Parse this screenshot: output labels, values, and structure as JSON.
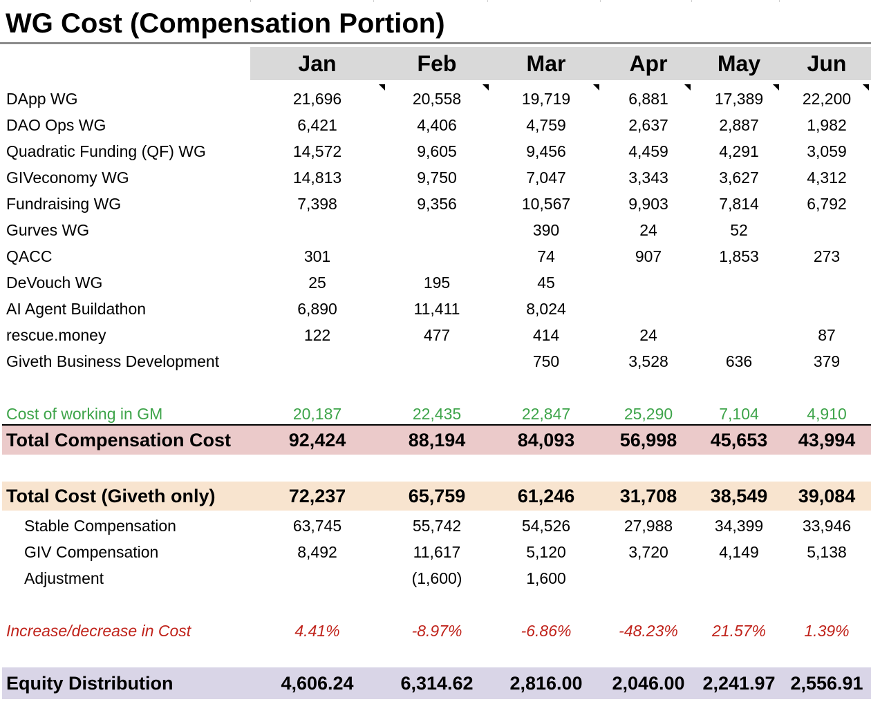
{
  "title": "WG Cost (Compensation Portion)",
  "months": [
    "Jan",
    "Feb",
    "Mar",
    "Apr",
    "May",
    "Jun"
  ],
  "wg_rows": [
    {
      "label": "DApp WG",
      "values": [
        "21,696",
        "20,558",
        "19,719",
        "6,881",
        "17,389",
        "22,200"
      ]
    },
    {
      "label": "DAO Ops WG",
      "values": [
        "6,421",
        "4,406",
        "4,759",
        "2,637",
        "2,887",
        "1,982"
      ]
    },
    {
      "label": "Quadratic Funding (QF) WG",
      "values": [
        "14,572",
        "9,605",
        "9,456",
        "4,459",
        "4,291",
        "3,059"
      ]
    },
    {
      "label": "GIVeconomy WG",
      "values": [
        "14,813",
        "9,750",
        "7,047",
        "3,343",
        "3,627",
        "4,312"
      ]
    },
    {
      "label": "Fundraising WG",
      "values": [
        "7,398",
        "9,356",
        "10,567",
        "9,903",
        "7,814",
        "6,792"
      ]
    },
    {
      "label": "Gurves WG",
      "values": [
        "",
        "",
        "390",
        "24",
        "52",
        ""
      ]
    },
    {
      "label": "QACC",
      "values": [
        "301",
        "",
        "74",
        "907",
        "1,853",
        "273"
      ]
    },
    {
      "label": "DeVouch WG",
      "values": [
        "25",
        "195",
        "45",
        "",
        "",
        ""
      ]
    },
    {
      "label": "AI Agent Buildathon",
      "values": [
        "6,890",
        "11,411",
        "8,024",
        "",
        "",
        ""
      ]
    },
    {
      "label": "rescue.money",
      "values": [
        "122",
        "477",
        "414",
        "24",
        "",
        "87"
      ]
    },
    {
      "label": "Giveth Business Development",
      "values": [
        "",
        "",
        "750",
        "3,528",
        "636",
        "379"
      ]
    }
  ],
  "gm_row": {
    "label": "Cost of working in GM",
    "values": [
      "20,187",
      "22,435",
      "22,847",
      "25,290",
      "7,104",
      "4,910"
    ]
  },
  "total_comp": {
    "label": "Total Compensation Cost",
    "values": [
      "92,424",
      "88,194",
      "84,093",
      "56,998",
      "45,653",
      "43,994"
    ]
  },
  "total_giveth": {
    "label": "Total Cost (Giveth only)",
    "values": [
      "72,237",
      "65,759",
      "61,246",
      "31,708",
      "38,549",
      "39,084"
    ]
  },
  "sub_rows": [
    {
      "label": "Stable Compensation",
      "values": [
        "63,745",
        "55,742",
        "54,526",
        "27,988",
        "34,399",
        "33,946"
      ]
    },
    {
      "label": "GIV Compensation",
      "values": [
        "8,492",
        "11,617",
        "5,120",
        "3,720",
        "4,149",
        "5,138"
      ]
    },
    {
      "label": "Adjustment",
      "values": [
        "",
        "(1,600)",
        "1,600",
        "",
        "",
        ""
      ]
    }
  ],
  "change_row": {
    "label": "Increase/decrease in Cost",
    "values": [
      "4.41%",
      "-8.97%",
      "-6.86%",
      "-48.23%",
      "21.57%",
      "1.39%"
    ]
  },
  "equity_row": {
    "label": "Equity Distribution",
    "values": [
      "4,606.24",
      "6,314.62",
      "2,816.00",
      "2,046.00",
      "2,241.97",
      "2,556.91"
    ]
  },
  "colors": {
    "header_band": "#d9d9d9",
    "total_comp_band": "#ebcaca",
    "total_giveth_band": "#f8e4cf",
    "equity_band": "#d9d5e7",
    "green_text": "#3ea44a",
    "red_text": "#c0231b"
  }
}
